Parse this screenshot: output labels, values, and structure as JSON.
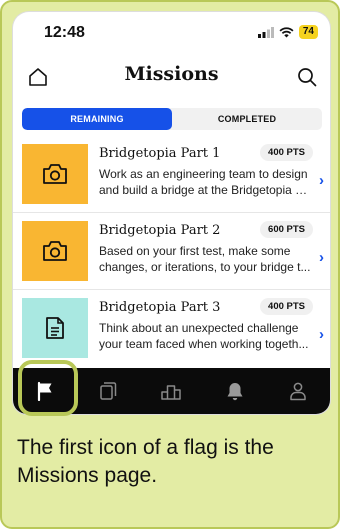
{
  "status_bar": {
    "time": "12:48",
    "battery": "74"
  },
  "header": {
    "title": "Missions",
    "home_icon": "home-icon",
    "search_icon": "search-icon"
  },
  "segmented": {
    "remaining_label": "REMAINING",
    "completed_label": "COMPLETED",
    "active": "REMAINING"
  },
  "missions": [
    {
      "name": "Bridgetopia Part 1",
      "points": "400 PTS",
      "description_line1": "Work as an engineering team to design",
      "description_line2": "and build a bridge at the Bridgetopia e...",
      "icon": "camera-icon",
      "thumb_color": "#f9b632"
    },
    {
      "name": "Bridgetopia Part 2",
      "points": "600 PTS",
      "description_line1": "Based on your first test, make some",
      "description_line2": "changes, or iterations, to your bridge t...",
      "icon": "camera-icon",
      "thumb_color": "#f9b632"
    },
    {
      "name": "Bridgetopia Part 3",
      "points": "400 PTS",
      "description_line1": "Think about an unexpected challenge",
      "description_line2": "your team faced when working togeth...",
      "icon": "document-icon",
      "thumb_color": "#a9e8e1"
    }
  ],
  "tabbar": {
    "items": [
      "flag-icon",
      "cards-icon",
      "leaderboard-icon",
      "bell-icon",
      "profile-icon"
    ],
    "active_index": 0
  },
  "caption": "The first icon of a flag is the Missions page.",
  "colors": {
    "accent": "#1651e8",
    "highlight": "#b9c858",
    "card_bg": "#e3eca4",
    "tabbar_bg": "#0b0b0b"
  }
}
